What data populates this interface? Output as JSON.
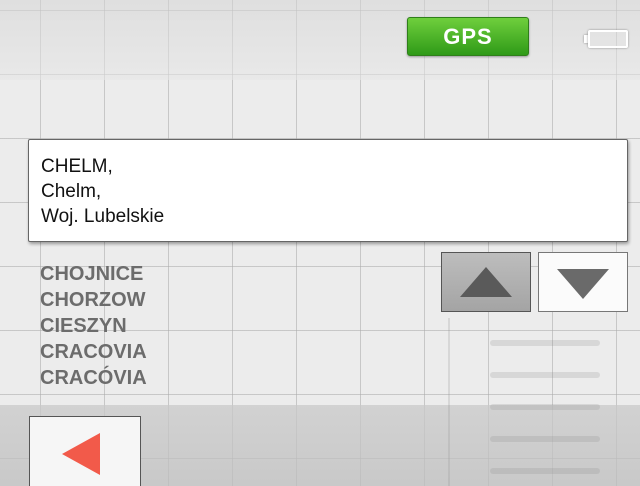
{
  "status_bar": {
    "gps_label": "GPS",
    "gps_color": "#3fae22",
    "battery_icon": "battery-icon"
  },
  "selected": {
    "lines": [
      "CHELM,",
      "Chelm,",
      "Woj. Lubelskie"
    ]
  },
  "results": [
    "CHOJNICE",
    "CHORZOW",
    "CIESZYN",
    "CRACOVIA",
    "CRACÓVIA"
  ],
  "controls": {
    "scroll_up_icon": "triangle-up-icon",
    "scroll_down_icon": "triangle-down-icon",
    "back_icon": "arrow-left-icon",
    "back_color": "#f25a4a"
  }
}
